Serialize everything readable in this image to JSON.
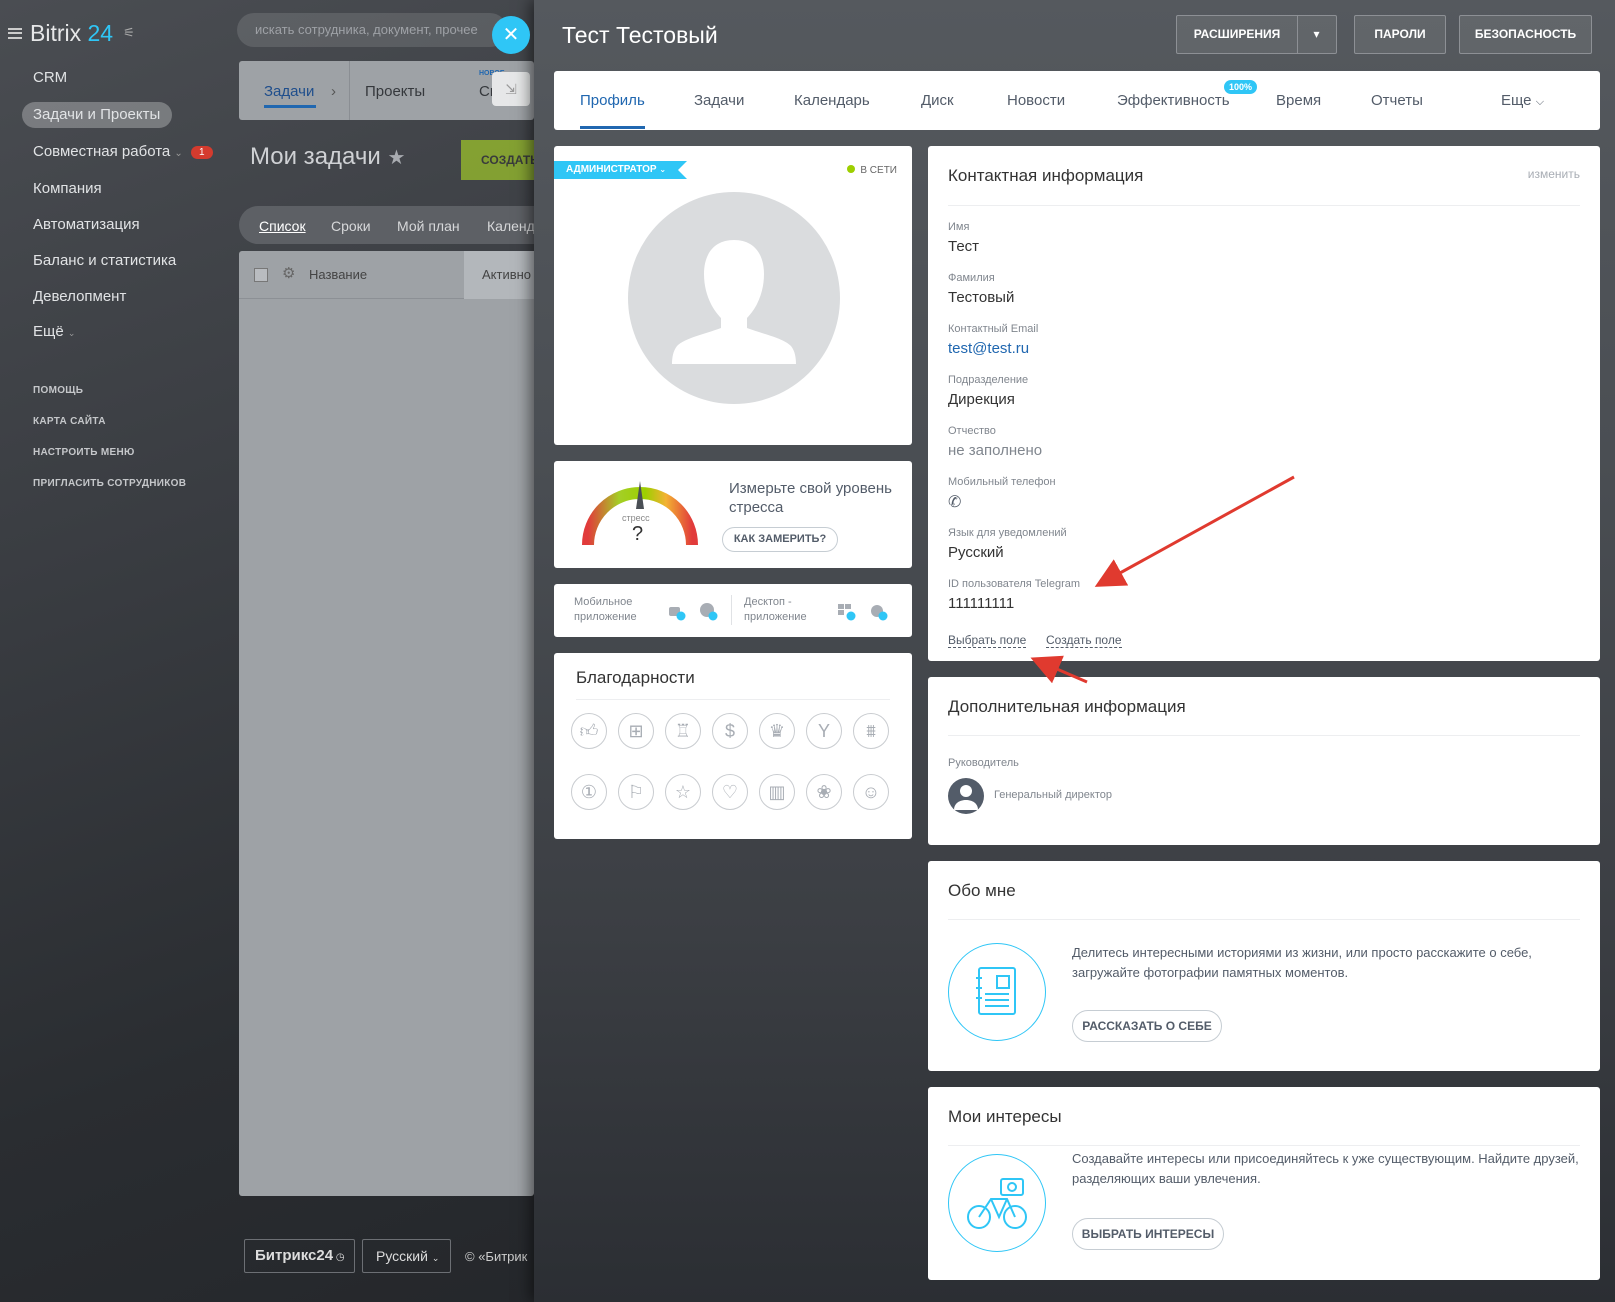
{
  "sidebar": {
    "logo_main": "Bitrix",
    "logo_num": "24",
    "items": [
      {
        "label": "CRM"
      },
      {
        "label": "Задачи и Проекты"
      },
      {
        "label": "Совместная работа",
        "badge": "1"
      },
      {
        "label": "Компания"
      },
      {
        "label": "Автоматизация"
      },
      {
        "label": "Баланс и статистика"
      },
      {
        "label": "Девелопмент"
      },
      {
        "label": "Ещё"
      }
    ],
    "small_links": [
      "ПОМОЩЬ",
      "КАРТА САЙТА",
      "НАСТРОИТЬ МЕНЮ",
      "ПРИГЛАСИТЬ СОТРУДНИКОВ"
    ]
  },
  "search": {
    "placeholder": "искать сотрудника, документ, прочее"
  },
  "workspace": {
    "tabs": [
      "Задачи",
      "Проекты",
      "Ск"
    ],
    "tab_new_badge": "НОВОЕ",
    "title": "Мои задачи",
    "create_label": "СОЗДАТЬ",
    "filters": [
      "Список",
      "Сроки",
      "Мой план",
      "Календ"
    ],
    "grid_headers": [
      "Название",
      "Активно"
    ],
    "footer_logo": "Битрикс24",
    "footer_lang": "Русский",
    "footer_copy": "© «Битрик"
  },
  "profile": {
    "name": "Тест Тестовый",
    "buttons": {
      "extensions": "РАСШИРЕНИЯ",
      "passwords": "ПАРОЛИ",
      "security": "БЕЗОПАСНОСТЬ"
    },
    "tabs": [
      "Профиль",
      "Задачи",
      "Календарь",
      "Диск",
      "Новости",
      "Эффективность",
      "Время",
      "Отчеты",
      "Еще"
    ],
    "efficiency_badge": "100%",
    "role_badge": "АДМИНИСТРАТОР",
    "status": "В СЕТИ",
    "stress": {
      "gauge_label": "стресс",
      "gauge_value": "?",
      "text": "Измерьте свой уровень стресса",
      "button": "КАК ЗАМЕРИТЬ?"
    },
    "apps": {
      "mobile": "Мобильное приложение",
      "desktop": "Десктоп - приложение"
    },
    "thanks_title": "Благодарности",
    "contact": {
      "title": "Контактная информация",
      "edit": "изменить",
      "fields": [
        {
          "label": "Имя",
          "value": "Тест"
        },
        {
          "label": "Фамилия",
          "value": "Тестовый"
        },
        {
          "label": "Контактный Email",
          "value": "test@test.ru"
        },
        {
          "label": "Подразделение",
          "value": "Дирекция"
        },
        {
          "label": "Отчество",
          "value": "не заполнено"
        },
        {
          "label": "Мобильный телефон",
          "value": ""
        },
        {
          "label": "Язык для уведомлений",
          "value": "Русский"
        },
        {
          "label": "ID пользователя Telegram",
          "value": "111111111"
        }
      ],
      "select_field": "Выбрать поле",
      "create_field": "Создать поле"
    },
    "additional": {
      "title": "Дополнительная информация",
      "manager_label": "Руководитель",
      "manager_name": "Генеральный директор"
    },
    "about": {
      "title": "Обо мне",
      "text": "Делитесь интересными историями из жизни, или просто расскажите о себе, загружайте фотографии памятных моментов.",
      "button": "РАССКАЗАТЬ О СЕБЕ"
    },
    "interests": {
      "title": "Мои интересы",
      "text": "Создавайте интересы или присоединяйтесь к уже существующим. Найдите друзей, разделяющих ваши увлечения.",
      "button": "ВЫБРАТЬ ИНТЕРЕСЫ"
    }
  },
  "colors": {
    "accent": "#2fc6f6",
    "link": "#2067b0",
    "online": "#9dcf00",
    "badge": "#d43b2e",
    "annotation_arrow": "#e03a2f"
  }
}
